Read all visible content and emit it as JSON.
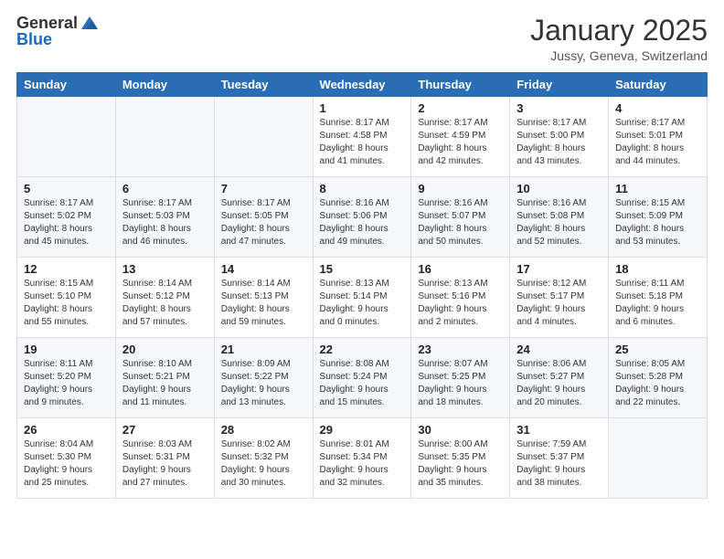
{
  "logo": {
    "general": "General",
    "blue": "Blue"
  },
  "header": {
    "month": "January 2025",
    "location": "Jussy, Geneva, Switzerland"
  },
  "weekdays": [
    "Sunday",
    "Monday",
    "Tuesday",
    "Wednesday",
    "Thursday",
    "Friday",
    "Saturday"
  ],
  "weeks": [
    [
      {
        "day": "",
        "info": ""
      },
      {
        "day": "",
        "info": ""
      },
      {
        "day": "",
        "info": ""
      },
      {
        "day": "1",
        "info": "Sunrise: 8:17 AM\nSunset: 4:58 PM\nDaylight: 8 hours\nand 41 minutes."
      },
      {
        "day": "2",
        "info": "Sunrise: 8:17 AM\nSunset: 4:59 PM\nDaylight: 8 hours\nand 42 minutes."
      },
      {
        "day": "3",
        "info": "Sunrise: 8:17 AM\nSunset: 5:00 PM\nDaylight: 8 hours\nand 43 minutes."
      },
      {
        "day": "4",
        "info": "Sunrise: 8:17 AM\nSunset: 5:01 PM\nDaylight: 8 hours\nand 44 minutes."
      }
    ],
    [
      {
        "day": "5",
        "info": "Sunrise: 8:17 AM\nSunset: 5:02 PM\nDaylight: 8 hours\nand 45 minutes."
      },
      {
        "day": "6",
        "info": "Sunrise: 8:17 AM\nSunset: 5:03 PM\nDaylight: 8 hours\nand 46 minutes."
      },
      {
        "day": "7",
        "info": "Sunrise: 8:17 AM\nSunset: 5:05 PM\nDaylight: 8 hours\nand 47 minutes."
      },
      {
        "day": "8",
        "info": "Sunrise: 8:16 AM\nSunset: 5:06 PM\nDaylight: 8 hours\nand 49 minutes."
      },
      {
        "day": "9",
        "info": "Sunrise: 8:16 AM\nSunset: 5:07 PM\nDaylight: 8 hours\nand 50 minutes."
      },
      {
        "day": "10",
        "info": "Sunrise: 8:16 AM\nSunset: 5:08 PM\nDaylight: 8 hours\nand 52 minutes."
      },
      {
        "day": "11",
        "info": "Sunrise: 8:15 AM\nSunset: 5:09 PM\nDaylight: 8 hours\nand 53 minutes."
      }
    ],
    [
      {
        "day": "12",
        "info": "Sunrise: 8:15 AM\nSunset: 5:10 PM\nDaylight: 8 hours\nand 55 minutes."
      },
      {
        "day": "13",
        "info": "Sunrise: 8:14 AM\nSunset: 5:12 PM\nDaylight: 8 hours\nand 57 minutes."
      },
      {
        "day": "14",
        "info": "Sunrise: 8:14 AM\nSunset: 5:13 PM\nDaylight: 8 hours\nand 59 minutes."
      },
      {
        "day": "15",
        "info": "Sunrise: 8:13 AM\nSunset: 5:14 PM\nDaylight: 9 hours\nand 0 minutes."
      },
      {
        "day": "16",
        "info": "Sunrise: 8:13 AM\nSunset: 5:16 PM\nDaylight: 9 hours\nand 2 minutes."
      },
      {
        "day": "17",
        "info": "Sunrise: 8:12 AM\nSunset: 5:17 PM\nDaylight: 9 hours\nand 4 minutes."
      },
      {
        "day": "18",
        "info": "Sunrise: 8:11 AM\nSunset: 5:18 PM\nDaylight: 9 hours\nand 6 minutes."
      }
    ],
    [
      {
        "day": "19",
        "info": "Sunrise: 8:11 AM\nSunset: 5:20 PM\nDaylight: 9 hours\nand 9 minutes."
      },
      {
        "day": "20",
        "info": "Sunrise: 8:10 AM\nSunset: 5:21 PM\nDaylight: 9 hours\nand 11 minutes."
      },
      {
        "day": "21",
        "info": "Sunrise: 8:09 AM\nSunset: 5:22 PM\nDaylight: 9 hours\nand 13 minutes."
      },
      {
        "day": "22",
        "info": "Sunrise: 8:08 AM\nSunset: 5:24 PM\nDaylight: 9 hours\nand 15 minutes."
      },
      {
        "day": "23",
        "info": "Sunrise: 8:07 AM\nSunset: 5:25 PM\nDaylight: 9 hours\nand 18 minutes."
      },
      {
        "day": "24",
        "info": "Sunrise: 8:06 AM\nSunset: 5:27 PM\nDaylight: 9 hours\nand 20 minutes."
      },
      {
        "day": "25",
        "info": "Sunrise: 8:05 AM\nSunset: 5:28 PM\nDaylight: 9 hours\nand 22 minutes."
      }
    ],
    [
      {
        "day": "26",
        "info": "Sunrise: 8:04 AM\nSunset: 5:30 PM\nDaylight: 9 hours\nand 25 minutes."
      },
      {
        "day": "27",
        "info": "Sunrise: 8:03 AM\nSunset: 5:31 PM\nDaylight: 9 hours\nand 27 minutes."
      },
      {
        "day": "28",
        "info": "Sunrise: 8:02 AM\nSunset: 5:32 PM\nDaylight: 9 hours\nand 30 minutes."
      },
      {
        "day": "29",
        "info": "Sunrise: 8:01 AM\nSunset: 5:34 PM\nDaylight: 9 hours\nand 32 minutes."
      },
      {
        "day": "30",
        "info": "Sunrise: 8:00 AM\nSunset: 5:35 PM\nDaylight: 9 hours\nand 35 minutes."
      },
      {
        "day": "31",
        "info": "Sunrise: 7:59 AM\nSunset: 5:37 PM\nDaylight: 9 hours\nand 38 minutes."
      },
      {
        "day": "",
        "info": ""
      }
    ]
  ]
}
